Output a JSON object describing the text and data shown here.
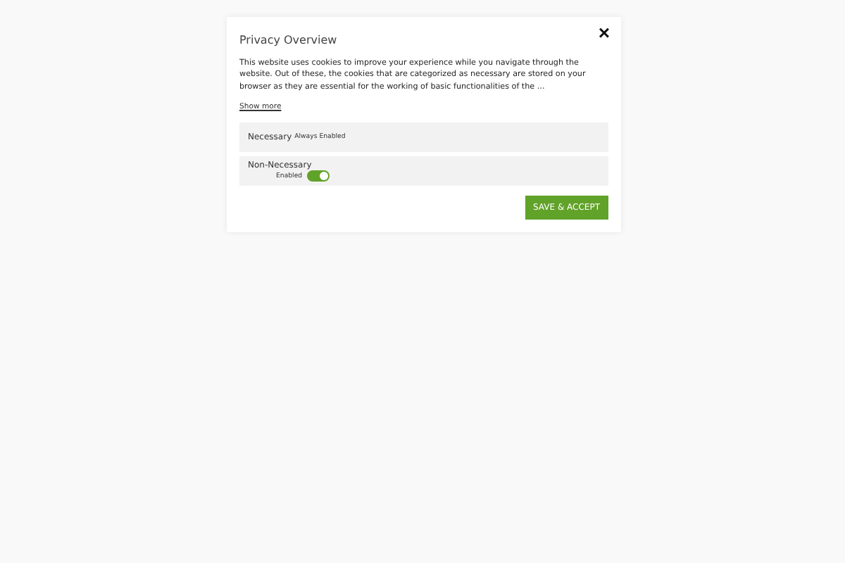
{
  "modal": {
    "title": "Privacy Overview",
    "close": "×",
    "description": "This website uses cookies to improve your experience while you navigate through the website. Out of these, the cookies that are categorized as necessary are stored on your browser as they are essential for the working of basic functionalities of the ...",
    "show_more": "Show more",
    "categories": [
      {
        "name": "Necessary",
        "kind": "fixed",
        "status": "Always Enabled"
      },
      {
        "name": "Non-Necessary",
        "kind": "toggle",
        "status": "Enabled",
        "on": true
      }
    ],
    "save_button": "SAVE & ACCEPT"
  }
}
